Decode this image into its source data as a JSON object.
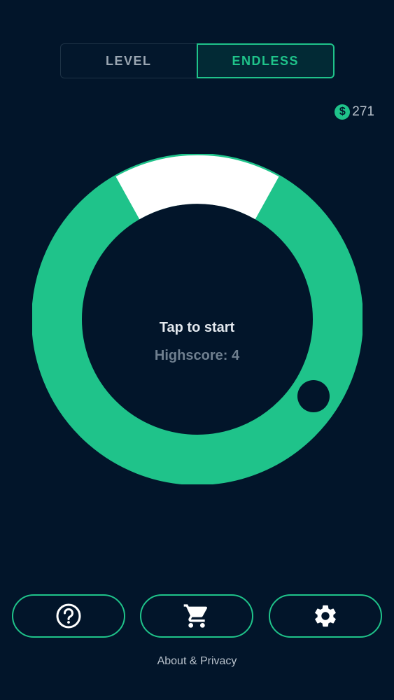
{
  "mode_toggle": {
    "level_label": "LEVEL",
    "endless_label": "ENDLESS",
    "selected": "ENDLESS"
  },
  "coins": {
    "symbol": "$",
    "amount": "271"
  },
  "game": {
    "tap_prompt": "Tap to start",
    "highscore_text": "Highscore: 4"
  },
  "buttons": {
    "help_icon": "help-circle-icon",
    "shop_icon": "shopping-cart-icon",
    "settings_icon": "gear-icon"
  },
  "footer": {
    "about_label": "About & Privacy"
  },
  "colors": {
    "background": "#02152a",
    "accent": "#1fc38a",
    "gap_segment": "#ffffff",
    "text_primary": "#e3e8ee",
    "text_muted": "#6f7f8f"
  }
}
